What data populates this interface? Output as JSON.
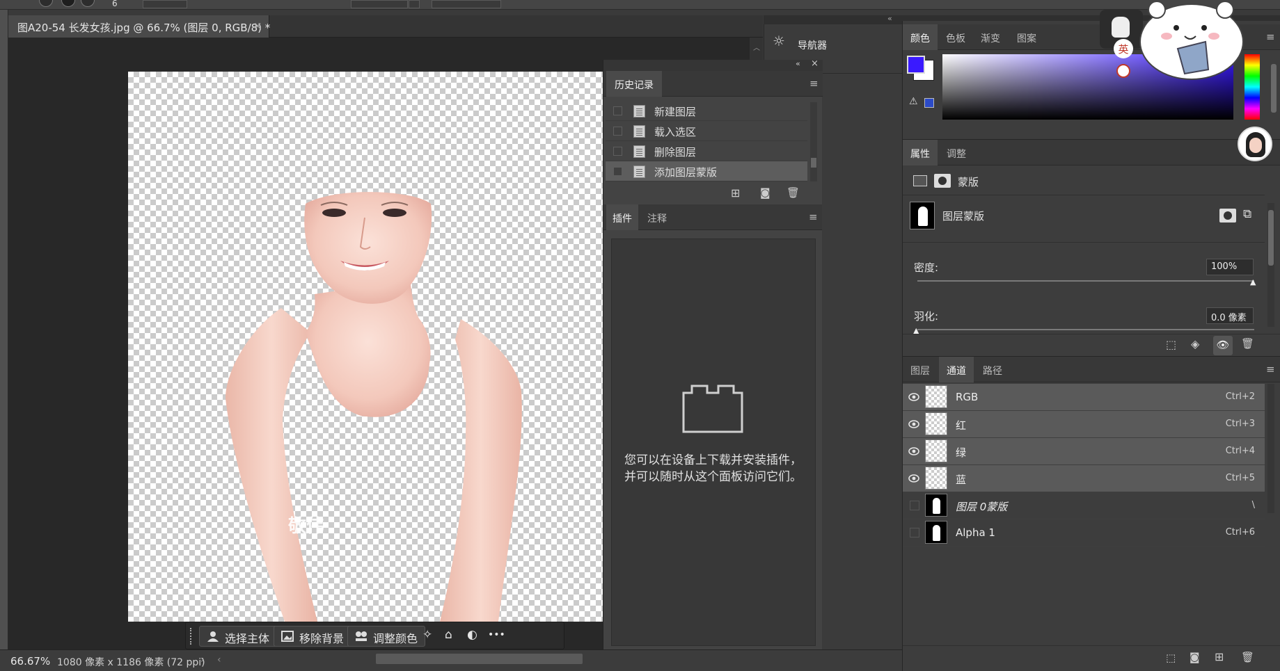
{
  "toolbar": {
    "size_value": "6"
  },
  "document": {
    "tab_title": "图A20-54 长发女孩.jpg @ 66.7% (图层 0, RGB/8) *",
    "close_glyph": "×",
    "watermark": "敬伟"
  },
  "taskbar": {
    "select_subject": "选择主体",
    "remove_background": "移除背景",
    "adjust_color": "调整颜色",
    "more_glyph": "•••"
  },
  "status": {
    "zoom": "66.67%",
    "doc_info": "1080 像素 x 1186 像素 (72 ppi)",
    "arrow": "›",
    "left_arrow": "‹"
  },
  "navigator": {
    "label": "导航器"
  },
  "history_panel": {
    "tab": "历史记录",
    "items": [
      "新建图层",
      "载入选区",
      "删除图层",
      "添加图层蒙版"
    ]
  },
  "plugins_panel": {
    "tabs": [
      "插件",
      "注释"
    ],
    "empty_text": "您可以在设备上下载并安装插件，并可以随时从这个面板访问它们。"
  },
  "color_panel": {
    "tabs": [
      "颜色",
      "色板",
      "渐变",
      "图案"
    ],
    "foreground_color": "#3a1aff",
    "background_color": "#ffffff"
  },
  "properties_panel": {
    "tabs": [
      "属性",
      "调整"
    ],
    "mask_type": "蒙版",
    "layer_mask": "图层蒙版",
    "density_label": "密度:",
    "density_value": "100%",
    "density_fraction": 1.0,
    "feather_label": "羽化:",
    "feather_value": "0.0 像素",
    "feather_fraction": 0.0
  },
  "channels_panel": {
    "tabs": [
      "图层",
      "通道",
      "路径"
    ],
    "channels": [
      {
        "name": "RGB",
        "shortcut": "Ctrl+2",
        "visible": true,
        "selected": true,
        "mask": false
      },
      {
        "name": "红",
        "shortcut": "Ctrl+3",
        "visible": true,
        "selected": true,
        "mask": false
      },
      {
        "name": "绿",
        "shortcut": "Ctrl+4",
        "visible": true,
        "selected": true,
        "mask": false
      },
      {
        "name": "蓝",
        "shortcut": "Ctrl+5",
        "visible": true,
        "selected": true,
        "mask": false
      },
      {
        "name": "图层 0蒙版",
        "shortcut": "\\",
        "visible": false,
        "selected": false,
        "mask": true
      },
      {
        "name": "Alpha 1",
        "shortcut": "Ctrl+6",
        "visible": false,
        "selected": false,
        "mask": true
      }
    ]
  },
  "overlay": {
    "ime_label": "英"
  }
}
